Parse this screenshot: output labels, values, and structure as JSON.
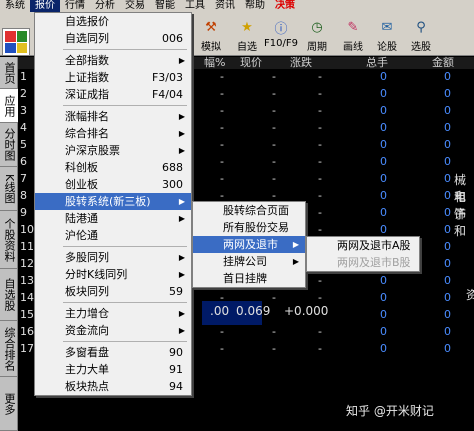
{
  "menubar": [
    "系统",
    "报价",
    "行情",
    "分析",
    "交易",
    "智能",
    "工具",
    "资讯",
    "帮助",
    "决策"
  ],
  "toolbar": {
    "buttons": [
      {
        "label": "模拟",
        "icon": "hammer-icon"
      },
      {
        "label": "自选",
        "icon": "star-icon"
      },
      {
        "label": "F10/F9",
        "icon": "info-icon"
      },
      {
        "label": "周期",
        "icon": "clock-icon"
      },
      {
        "label": "画线",
        "icon": "pen-icon"
      },
      {
        "label": "论股",
        "icon": "chat-icon"
      },
      {
        "label": "选股",
        "icon": "filter-icon"
      }
    ]
  },
  "left_tabs": [
    "首页",
    "应用",
    "分时图",
    "K线图",
    "个股资料",
    "自选股",
    "综合排名",
    "更多"
  ],
  "header": {
    "c1": "幅%",
    "c2": "现价",
    "c3": "涨跌",
    "c4": "总手",
    "c5": "金额"
  },
  "rows": [
    "1",
    "2",
    "3",
    "4",
    "5",
    "6",
    "7",
    "8",
    "9",
    "10",
    "11",
    "12",
    "13",
    "14",
    "15",
    "16",
    "17"
  ],
  "row15": {
    "a": ".00",
    "b": "0.069",
    "c": "+0.000"
  },
  "side": {
    "t1": "械和",
    "t2": "电子",
    "t3": "饰和",
    "t4": "资"
  },
  "menu_main": [
    {
      "label": "自选报价",
      "sc": "",
      "sub": false
    },
    {
      "label": "自选同列",
      "sc": "006",
      "sub": false
    },
    {
      "sep": true
    },
    {
      "label": "全部指数",
      "sc": "",
      "sub": true
    },
    {
      "label": "上证指数",
      "sc": "F3/03",
      "sub": false
    },
    {
      "label": "深证成指",
      "sc": "F4/04",
      "sub": false
    },
    {
      "sep": true
    },
    {
      "label": "涨幅排名",
      "sc": "",
      "sub": true
    },
    {
      "label": "综合排名",
      "sc": "",
      "sub": true
    },
    {
      "label": "沪深京股票",
      "sc": "",
      "sub": true
    },
    {
      "label": "科创板",
      "sc": "688",
      "sub": false
    },
    {
      "label": "创业板",
      "sc": "300",
      "sub": false
    },
    {
      "label": "股转系统(新三板)",
      "sc": "",
      "sub": true,
      "hl": true
    },
    {
      "label": "陆港通",
      "sc": "",
      "sub": true
    },
    {
      "label": "沪伦通",
      "sc": "",
      "sub": false
    },
    {
      "sep": true
    },
    {
      "label": "多股同列",
      "sc": "",
      "sub": true
    },
    {
      "label": "分时K线同列",
      "sc": "",
      "sub": true
    },
    {
      "label": "板块同列",
      "sc": "59",
      "sub": false
    },
    {
      "sep": true
    },
    {
      "label": "主力增仓",
      "sc": "",
      "sub": true
    },
    {
      "label": "资金流向",
      "sc": "",
      "sub": true
    },
    {
      "sep": true
    },
    {
      "label": "多窗看盘",
      "sc": "90",
      "sub": false
    },
    {
      "label": "主力大单",
      "sc": "91",
      "sub": false
    },
    {
      "label": "板块热点",
      "sc": "94",
      "sub": false
    }
  ],
  "menu_sub": [
    {
      "label": "股转综合页面",
      "sub": false
    },
    {
      "label": "所有股份交易",
      "sub": false
    },
    {
      "label": "两网及退市",
      "sub": true,
      "hl": true
    },
    {
      "label": "挂牌公司",
      "sub": true
    },
    {
      "label": "首日挂牌",
      "sub": false
    }
  ],
  "menu_sub2": [
    {
      "label": "两网及退市A股",
      "dis": false
    },
    {
      "label": "两网及退市B股",
      "dis": true
    }
  ],
  "watermark": "知乎 @开米财记"
}
